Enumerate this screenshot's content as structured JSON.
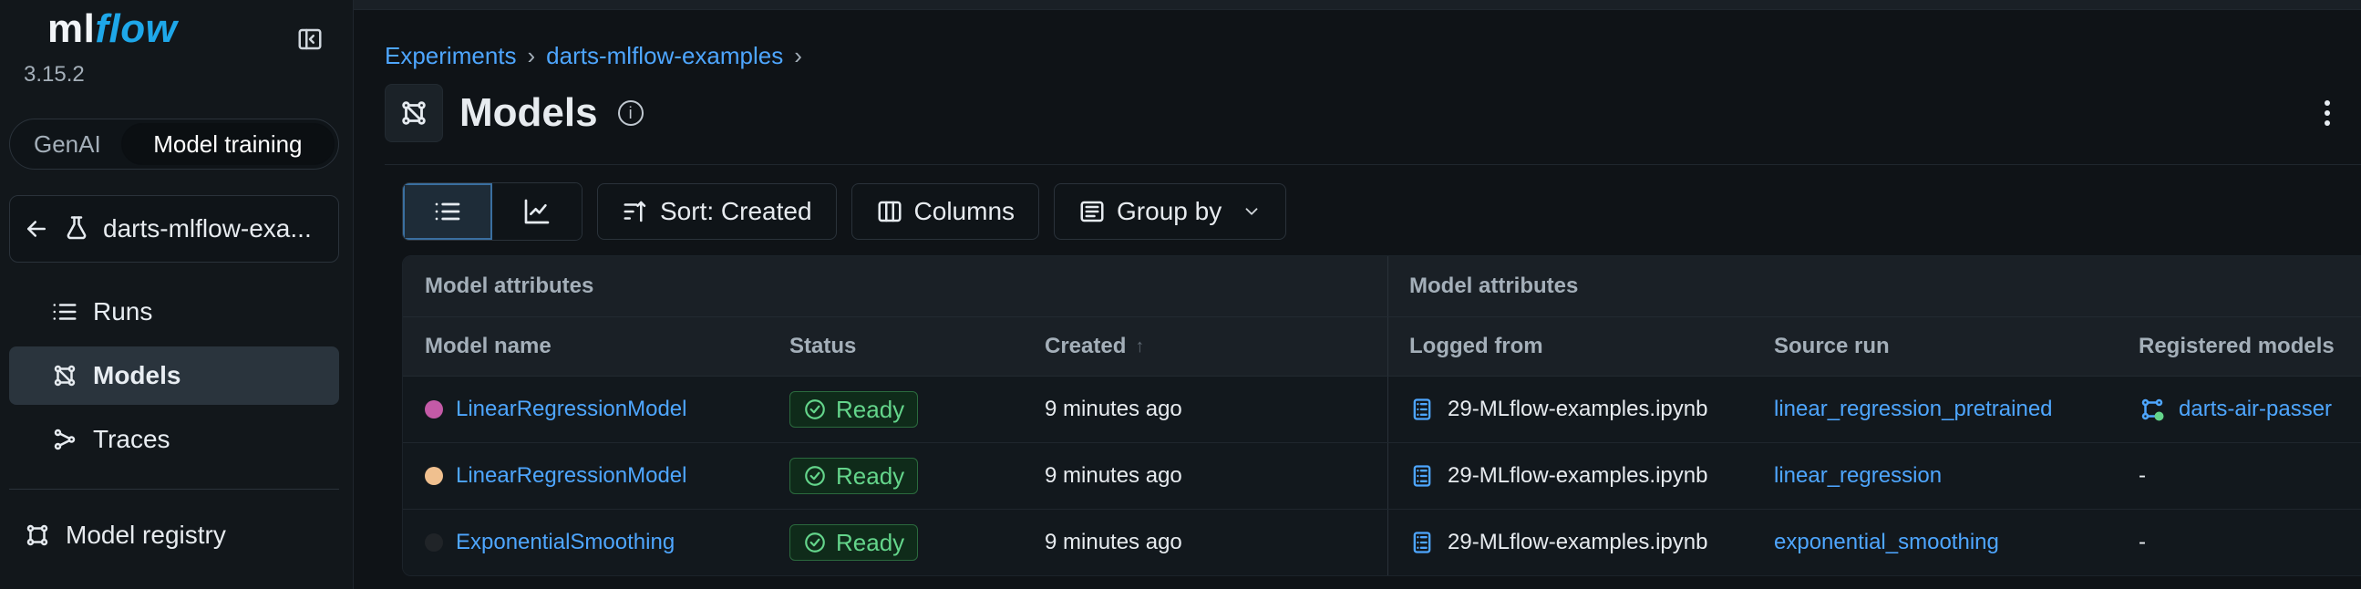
{
  "colors": {
    "accent_link": "#4ea6ff",
    "ready_green": "#64d58b",
    "dot_pink": "#c45aa7",
    "dot_peach": "#f0c08f",
    "dot_black": "#202428",
    "logo_accent": "#1ea7e9"
  },
  "sidebar": {
    "logo_left": "ml",
    "logo_right": "flow",
    "version": "3.15.2",
    "mode_options": [
      {
        "label": "GenAI",
        "active": false
      },
      {
        "label": "Model training",
        "active": true
      }
    ],
    "experiment_label": "darts-mlflow-exa...",
    "nav": [
      {
        "label": "Runs",
        "icon": "list-icon",
        "active": false
      },
      {
        "label": "Models",
        "icon": "models-icon",
        "active": true
      },
      {
        "label": "Traces",
        "icon": "traces-icon",
        "active": false
      }
    ],
    "registry_label": "Model registry"
  },
  "header": {
    "breadcrumbs": [
      {
        "label": "Experiments"
      },
      {
        "label": "darts-mlflow-examples"
      }
    ],
    "title": "Models",
    "info_icon": "info-icon",
    "more_icon": "kebab-icon"
  },
  "toolbar": {
    "sort_label": "Sort: Created",
    "columns_label": "Columns",
    "group_label": "Group by"
  },
  "table": {
    "group_headers": [
      "Model attributes",
      "Model attributes"
    ],
    "columns": [
      "Model name",
      "Status",
      "Created",
      "Logged from",
      "Source run",
      "Registered models"
    ],
    "rows": [
      {
        "model_name": "LinearRegressionModel",
        "status": "Ready",
        "created": "9 minutes ago",
        "logged_from": "29-MLflow-examples.ipynb",
        "source_run": "linear_regression_pretrained",
        "registered_models": "darts-air-passer",
        "dot_color_key": "dot_pink"
      },
      {
        "model_name": "LinearRegressionModel",
        "status": "Ready",
        "created": "9 minutes ago",
        "logged_from": "29-MLflow-examples.ipynb",
        "source_run": "linear_regression",
        "registered_models": "-",
        "dot_color_key": "dot_peach"
      },
      {
        "model_name": "ExponentialSmoothing",
        "status": "Ready",
        "created": "9 minutes ago",
        "logged_from": "29-MLflow-examples.ipynb",
        "source_run": "exponential_smoothing",
        "registered_models": "-",
        "dot_color_key": "dot_black"
      }
    ]
  }
}
